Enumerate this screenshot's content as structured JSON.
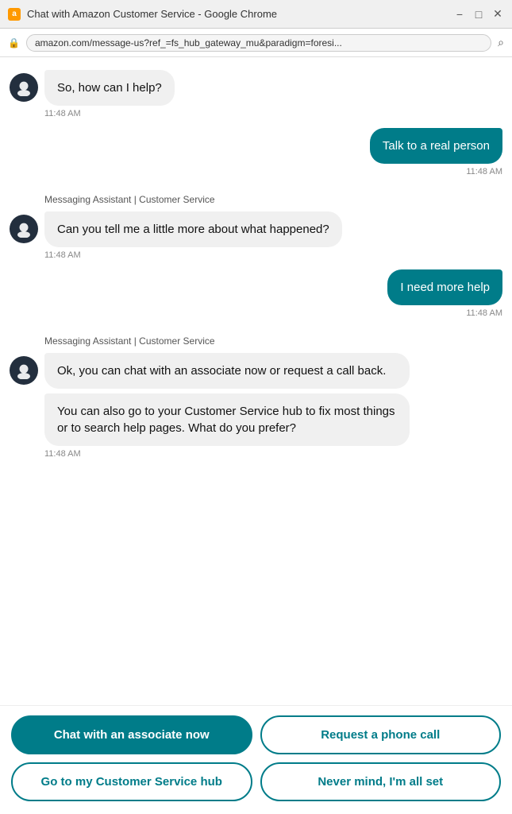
{
  "titleBar": {
    "icon": "a",
    "title": "Chat with Amazon Customer Service - Google Chrome",
    "minimize": "−",
    "restore": "□",
    "close": "✕"
  },
  "addressBar": {
    "lock": "🔒",
    "url": "amazon.com/message-us?ref_=fs_hub_gateway_mu&paradigm=foresi...",
    "search": "🔍"
  },
  "chat": {
    "messages": [
      {
        "id": "msg1",
        "type": "bot",
        "bubbles": [
          "So, how can I help?"
        ],
        "timestamp": "11:48 AM",
        "showAvatar": true,
        "senderLabel": null
      },
      {
        "id": "msg2",
        "type": "user",
        "bubbles": [
          "Talk to a real person"
        ],
        "timestamp": "11:48 AM",
        "showAvatar": false,
        "senderLabel": null
      },
      {
        "id": "msg3",
        "type": "bot",
        "bubbles": [
          "Can you tell me a little more about what happened?"
        ],
        "timestamp": "11:48 AM",
        "showAvatar": true,
        "senderLabel": "Messaging Assistant | Customer Service"
      },
      {
        "id": "msg4",
        "type": "user",
        "bubbles": [
          "I need more help"
        ],
        "timestamp": "11:48 AM",
        "showAvatar": false,
        "senderLabel": null
      },
      {
        "id": "msg5",
        "type": "bot",
        "bubbles": [
          "Ok, you can chat with an associate now or request a call back.",
          "You can also go to your Customer Service hub to fix most things or to search help pages. What do you prefer?"
        ],
        "timestamp": "11:48 AM",
        "showAvatar": true,
        "senderLabel": "Messaging Assistant | Customer Service"
      }
    ]
  },
  "actions": [
    {
      "id": "chat-associate",
      "label": "Chat with an associate now",
      "style": "primary"
    },
    {
      "id": "request-phone",
      "label": "Request a phone call",
      "style": "secondary"
    },
    {
      "id": "go-hub",
      "label": "Go to my Customer Service hub",
      "style": "secondary"
    },
    {
      "id": "never-mind",
      "label": "Never mind, I'm all set",
      "style": "secondary"
    }
  ]
}
